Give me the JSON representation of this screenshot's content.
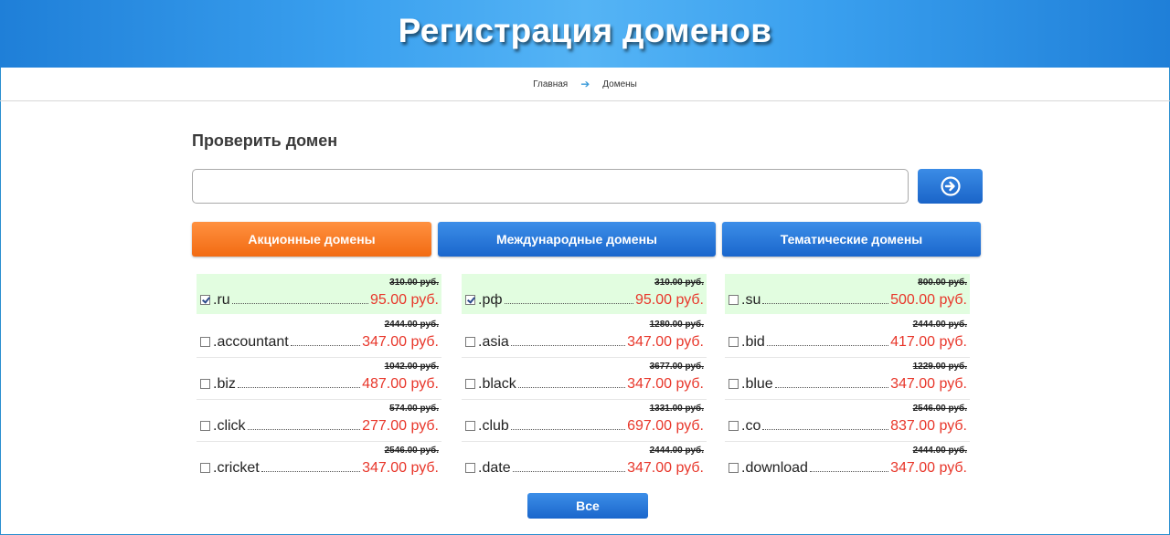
{
  "header": {
    "title": "Регистрация доменов"
  },
  "breadcrumb": {
    "home": "Главная",
    "current": "Домены"
  },
  "check": {
    "title": "Проверить домен",
    "input_value": "",
    "placeholder": ""
  },
  "tabs": [
    {
      "label": "Акционные домены",
      "active": true
    },
    {
      "label": "Международные домены",
      "active": false
    },
    {
      "label": "Тематические домены",
      "active": false
    }
  ],
  "columns": [
    [
      {
        "name": ".ru",
        "old_price": "310.00 руб.",
        "price": "95.00 руб.",
        "checked": true,
        "highlight": true
      },
      {
        "name": ".accountant",
        "old_price": "2444.00 руб.",
        "price": "347.00 руб.",
        "checked": false
      },
      {
        "name": ".biz",
        "old_price": "1042.00 руб.",
        "price": "487.00 руб.",
        "checked": false
      },
      {
        "name": ".click",
        "old_price": "574.00 руб.",
        "price": "277.00 руб.",
        "checked": false
      },
      {
        "name": ".cricket",
        "old_price": "2546.00 руб.",
        "price": "347.00 руб.",
        "checked": false
      }
    ],
    [
      {
        "name": ".рф",
        "old_price": "310.00 руб.",
        "price": "95.00 руб.",
        "checked": true,
        "highlight": true
      },
      {
        "name": ".asia",
        "old_price": "1280.00 руб.",
        "price": "347.00 руб.",
        "checked": false
      },
      {
        "name": ".black",
        "old_price": "3677.00 руб.",
        "price": "347.00 руб.",
        "checked": false
      },
      {
        "name": ".club",
        "old_price": "1331.00 руб.",
        "price": "697.00 руб.",
        "checked": false
      },
      {
        "name": ".date",
        "old_price": "2444.00 руб.",
        "price": "347.00 руб.",
        "checked": false
      }
    ],
    [
      {
        "name": ".su",
        "old_price": "800.00 руб.",
        "price": "500.00 руб.",
        "checked": false,
        "highlight": true
      },
      {
        "name": ".bid",
        "old_price": "2444.00 руб.",
        "price": "417.00 руб.",
        "checked": false
      },
      {
        "name": ".blue",
        "old_price": "1229.00 руб.",
        "price": "347.00 руб.",
        "checked": false
      },
      {
        "name": ".co",
        "old_price": "2546.00 руб.",
        "price": "837.00 руб.",
        "checked": false
      },
      {
        "name": ".download",
        "old_price": "2444.00 руб.",
        "price": "347.00 руб.",
        "checked": false
      }
    ]
  ],
  "all_button": {
    "label": "Все"
  },
  "icons": {
    "go": "arrow-circle-right-icon",
    "breadcrumb_separator": "arrow-right-icon"
  },
  "colors": {
    "accent_blue": "#1a66cc",
    "active_orange": "#f26b12",
    "price_red": "#e8362a",
    "highlight_green": "#e2fde0"
  }
}
